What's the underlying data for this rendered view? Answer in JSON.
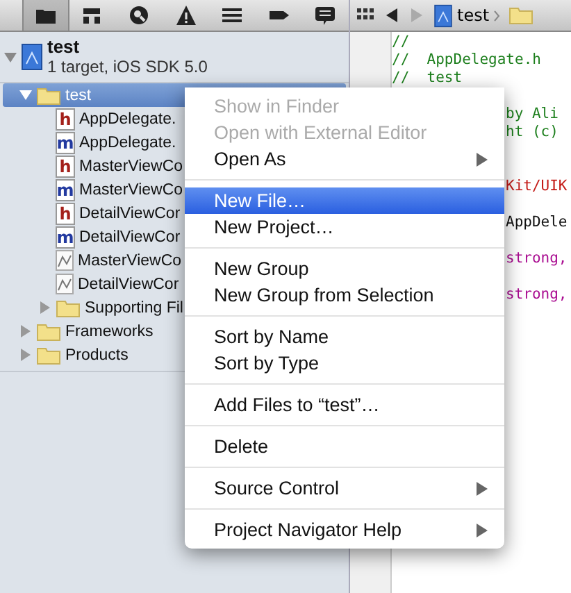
{
  "navigator": {
    "toolbar": [
      {
        "kind": "folder",
        "selected": true
      },
      {
        "kind": "hierarchy",
        "selected": false
      },
      {
        "kind": "search",
        "selected": false
      },
      {
        "kind": "warning",
        "selected": false
      },
      {
        "kind": "list",
        "selected": false
      },
      {
        "kind": "tag",
        "selected": false
      },
      {
        "kind": "bubble",
        "selected": false
      }
    ],
    "project": {
      "name": "test",
      "subtitle": "1 target, iOS SDK 5.0",
      "expanded": true
    },
    "tree": [
      {
        "name": "test",
        "kind": "folder",
        "selected": true,
        "expanded": true,
        "children": [
          {
            "name": "AppDelegate.",
            "kind": "header",
            "badge": "h",
            "selected": false
          },
          {
            "name": "AppDelegate.",
            "kind": "source",
            "badge": "m",
            "selected": false
          },
          {
            "name": "MasterViewCo",
            "kind": "header",
            "badge": "h",
            "selected": false
          },
          {
            "name": "MasterViewCo",
            "kind": "source",
            "badge": "m",
            "selected": false
          },
          {
            "name": "DetailViewCor",
            "kind": "header",
            "badge": "h",
            "selected": false
          },
          {
            "name": "DetailViewCor",
            "kind": "source",
            "badge": "m",
            "selected": false
          },
          {
            "name": "MasterViewCo",
            "kind": "xib",
            "selected": false
          },
          {
            "name": "DetailViewCor",
            "kind": "xib",
            "selected": false
          },
          {
            "name": "Supporting Fil",
            "kind": "folder",
            "selected": false,
            "expanded": false
          }
        ]
      },
      {
        "name": "Frameworks",
        "kind": "folder",
        "selected": false,
        "expanded": false
      },
      {
        "name": "Products",
        "kind": "folder",
        "selected": false,
        "expanded": false
      }
    ]
  },
  "editor": {
    "jump_bar": {
      "back_disabled": false,
      "forward_disabled": true,
      "path": [
        "test"
      ]
    },
    "lines": [
      {
        "kind": "comment",
        "text": "//"
      },
      {
        "kind": "comment",
        "text": "//  AppDelegate.h"
      },
      {
        "kind": "comment",
        "text": "//  test"
      },
      {
        "kind": "blank"
      },
      {
        "kind": "comment",
        "covered": true,
        "text": "by Ali"
      },
      {
        "kind": "comment",
        "covered": true,
        "text": "ht (c)"
      },
      {
        "kind": "blank"
      },
      {
        "kind": "blank"
      },
      {
        "kind": "import",
        "covered": true,
        "text": "Kit/UIK"
      },
      {
        "kind": "blank"
      },
      {
        "kind": "code",
        "covered": true,
        "text": "AppDele"
      },
      {
        "kind": "blank"
      },
      {
        "kind": "keyword",
        "covered": true,
        "text": "strong,"
      },
      {
        "kind": "blank"
      },
      {
        "kind": "keyword",
        "covered": true,
        "text": "strong,"
      }
    ]
  },
  "context_menu": {
    "sections": [
      [
        {
          "label": "Show in Finder",
          "disabled": true,
          "submenu": false,
          "selected": false
        },
        {
          "label": "Open with External Editor",
          "disabled": true,
          "submenu": false,
          "selected": false
        },
        {
          "label": "Open As",
          "disabled": false,
          "submenu": true,
          "selected": false
        }
      ],
      [
        {
          "label": "New File…",
          "disabled": false,
          "submenu": false,
          "selected": true
        },
        {
          "label": "New Project…",
          "disabled": false,
          "submenu": false,
          "selected": false
        }
      ],
      [
        {
          "label": "New Group",
          "disabled": false,
          "submenu": false,
          "selected": false
        },
        {
          "label": "New Group from Selection",
          "disabled": false,
          "submenu": false,
          "selected": false
        }
      ],
      [
        {
          "label": "Sort by Name",
          "disabled": false,
          "submenu": false,
          "selected": false
        },
        {
          "label": "Sort by Type",
          "disabled": false,
          "submenu": false,
          "selected": false
        }
      ],
      [
        {
          "label": "Add Files to “test”…",
          "disabled": false,
          "submenu": false,
          "selected": false
        }
      ],
      [
        {
          "label": "Delete",
          "disabled": false,
          "submenu": false,
          "selected": false
        }
      ],
      [
        {
          "label": "Source Control",
          "disabled": false,
          "submenu": true,
          "selected": false
        }
      ],
      [
        {
          "label": "Project Navigator Help",
          "disabled": false,
          "submenu": true,
          "selected": false
        }
      ]
    ]
  }
}
